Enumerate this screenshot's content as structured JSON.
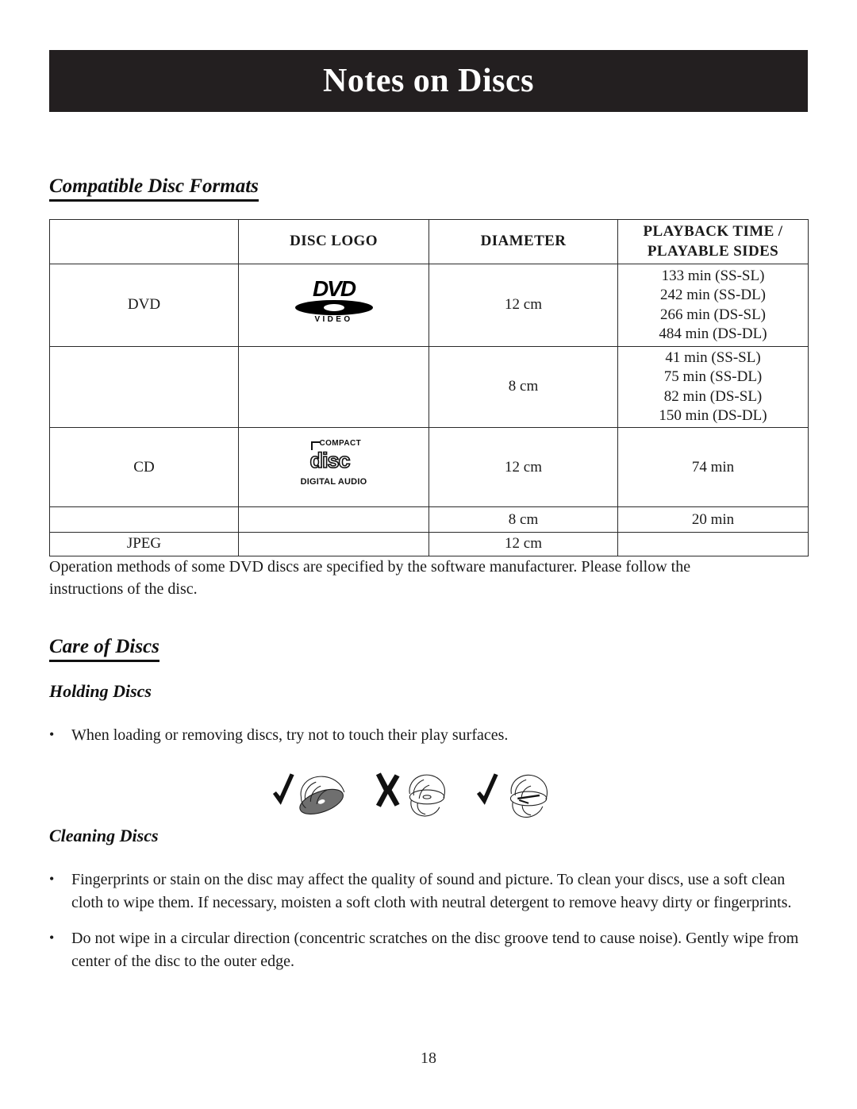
{
  "page": {
    "banner_title": "Notes on Discs",
    "page_number": "18",
    "banner_color": "#231f20"
  },
  "sections": {
    "compatible_formats": {
      "heading": "Compatible Disc Formats",
      "note": "Operation methods of some DVD discs are specified by the software manufacturer.  Please follow the instructions of the disc.",
      "table": {
        "headers": [
          "",
          "DISC LOGO",
          "DIAMETER",
          "PLAYBACK TIME / PLAYABLE SIDES"
        ],
        "header_line1": "PLAYBACK TIME /",
        "header_line2": "PLAYABLE SIDES",
        "header_logo": "DISC LOGO",
        "header_diameter": "DIAMETER",
        "rows": [
          {
            "name": "DVD",
            "logo": "dvd-video-logo",
            "diameter": "12 cm",
            "times": [
              "133 min (SS-SL)",
              "242 min (SS-DL)",
              "266 min (DS-SL)",
              "484 min (DS-DL)"
            ]
          },
          {
            "name": "",
            "logo": "",
            "diameter": "8 cm",
            "times": [
              "41 min (SS-SL)",
              "75 min (SS-DL)",
              "82 min (DS-SL)",
              "150 min (DS-DL)"
            ]
          },
          {
            "name": "CD",
            "logo": "compact-disc-digital-audio-logo",
            "diameter": "12 cm",
            "times": [
              "74 min"
            ]
          },
          {
            "name": "",
            "logo": "",
            "diameter": "8 cm",
            "times": [
              "20 min"
            ]
          },
          {
            "name": "JPEG",
            "logo": "",
            "diameter": "12 cm",
            "times": [
              ""
            ]
          }
        ]
      },
      "logos": {
        "dvd": {
          "word": "DVD",
          "sub": "VIDEO"
        },
        "cd": {
          "top": "COMPACT",
          "mid": "disc",
          "bottom": "DIGITAL AUDIO"
        }
      }
    },
    "care_of_discs": {
      "heading": "Care of Discs",
      "holding": {
        "heading": "Holding Discs",
        "bullet": "When loading or removing discs, try not to touch their play surfaces.",
        "illustrations": [
          {
            "mark": "check",
            "name": "hold-disc-by-edge-correct"
          },
          {
            "mark": "cross",
            "name": "touch-disc-surface-incorrect"
          },
          {
            "mark": "check",
            "name": "hold-disc-center-and-edge-correct"
          }
        ]
      },
      "cleaning": {
        "heading": "Cleaning Discs",
        "bullets": [
          "Fingerprints or stain on the disc may affect the quality of sound and picture.  To clean your discs, use a soft clean cloth to wipe them.  If necessary, moisten a soft cloth with neutral detergent to remove heavy dirty or fingerprints.",
          "Do not wipe in a circular direction (concentric scratches on the disc groove tend to cause noise).  Gently wipe from center of the disc to the outer edge."
        ]
      }
    }
  },
  "symbols": {
    "bullet": "•"
  }
}
